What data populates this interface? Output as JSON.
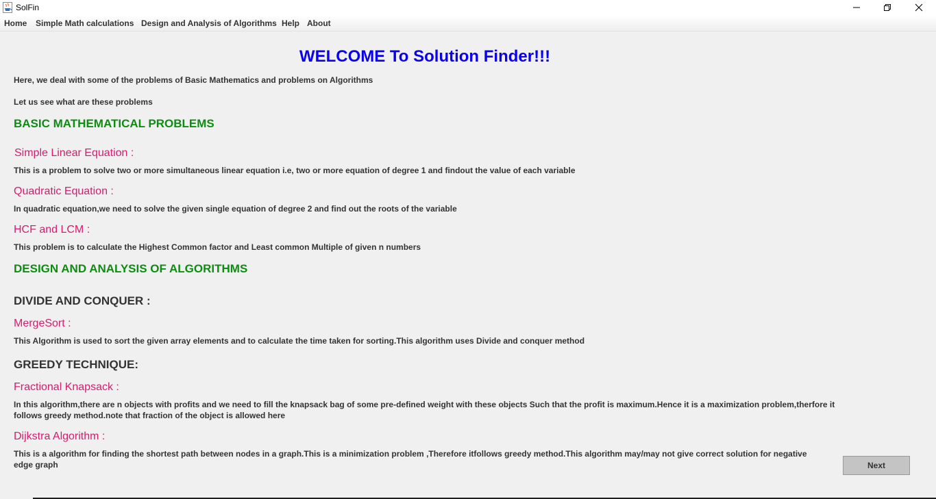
{
  "window": {
    "title": "SolFin",
    "app_icon": "java-cup-icon"
  },
  "menu": {
    "items": [
      "Home",
      "Simple Math calculations",
      "Design and Analysis of Algorithms",
      "Help",
      "About"
    ]
  },
  "content": {
    "welcome": "WELCOME To Solution Finder!!!",
    "intro1": "Here, we deal with some of the problems of Basic Mathematics and problems on Algorithms",
    "intro2": "Let us see what are these problems",
    "basic_heading": "BASIC MATHEMATICAL PROBLEMS",
    "linear_heading": "Simple Linear Equation :",
    "linear_desc": "This is a problem to solve two or more simultaneous linear equation i.e, two or more equation of degree 1 and findout the value of each variable",
    "quadratic_heading": "Quadratic Equation :",
    "quadratic_desc": "In quadratic equation,we need to solve the given single equation of degree 2 and find out the roots of the variable",
    "hcf_heading": "HCF and LCM :",
    "hcf_desc": "This problem is to calculate the Highest Common factor and Least common Multiple of given n numbers",
    "daa_heading": "DESIGN AND ANALYSIS OF ALGORITHMS",
    "dc_heading": "DIVIDE AND CONQUER :",
    "mergesort_heading": "MergeSort :",
    "mergesort_desc": "This Algorithm is used to sort the given array elements and to calculate the time taken for sorting.This algorithm uses Divide and conquer method",
    "greedy_heading": "GREEDY TECHNIQUE:",
    "knapsack_heading": "Fractional Knapsack :",
    "knapsack_desc": "In this algorithm,there are n objects with profits and we need to fill the knapsack bag of some pre-defined weight with these objects Such that the profit is maximum.Hence it is a maximization problem,therfore it follows greedy method.note that fraction of the object is allowed here",
    "dijkstra_heading": "Dijkstra Algorithm :",
    "dijkstra_desc": "This is a algorithm for finding the shortest path between nodes in a graph.This is a minimization problem ,Therefore itfollows greedy method.This algorithm may/may not give correct solution for negative edge graph",
    "next_label": "Next"
  },
  "colors": {
    "welcome": "#0a00f0",
    "section_heading": "#0e8c12",
    "topic_heading": "#d81b70",
    "body_text": "#333333"
  }
}
